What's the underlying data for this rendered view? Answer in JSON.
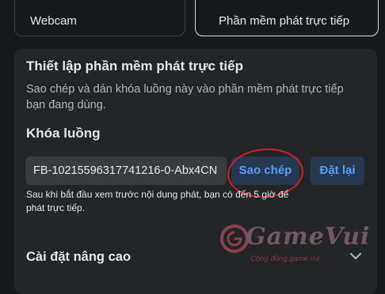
{
  "sources": {
    "webcam": "Webcam",
    "streaming_software": "Phần mềm phát trực tiếp"
  },
  "setup": {
    "title": "Thiết lập phần mềm phát trực tiếp",
    "description": "Sao chép và dán khóa luồng này vào phần mềm phát trực tiếp bạn đang dùng.",
    "key_label": "Khóa luồng",
    "key_value": "FB-10215596317741216-0-Abx4CN",
    "copy_label": "Sao chép",
    "reset_label": "Đặt lại",
    "note": "Sau khi bắt đầu xem trước nội dung phát, bạn có đến 5 giờ để phát trực tiếp."
  },
  "advanced": {
    "label": "Cài đặt nâng cao",
    "icon": "chevron-down-icon"
  },
  "watermark": {
    "brand": "GameVui",
    "slogan": "Cộng đồng game vui"
  },
  "colors": {
    "background": "#18191a",
    "panel": "#242526",
    "button_bg": "#263951",
    "button_text": "#5b9cf5",
    "highlight_circle": "#d21c30"
  }
}
